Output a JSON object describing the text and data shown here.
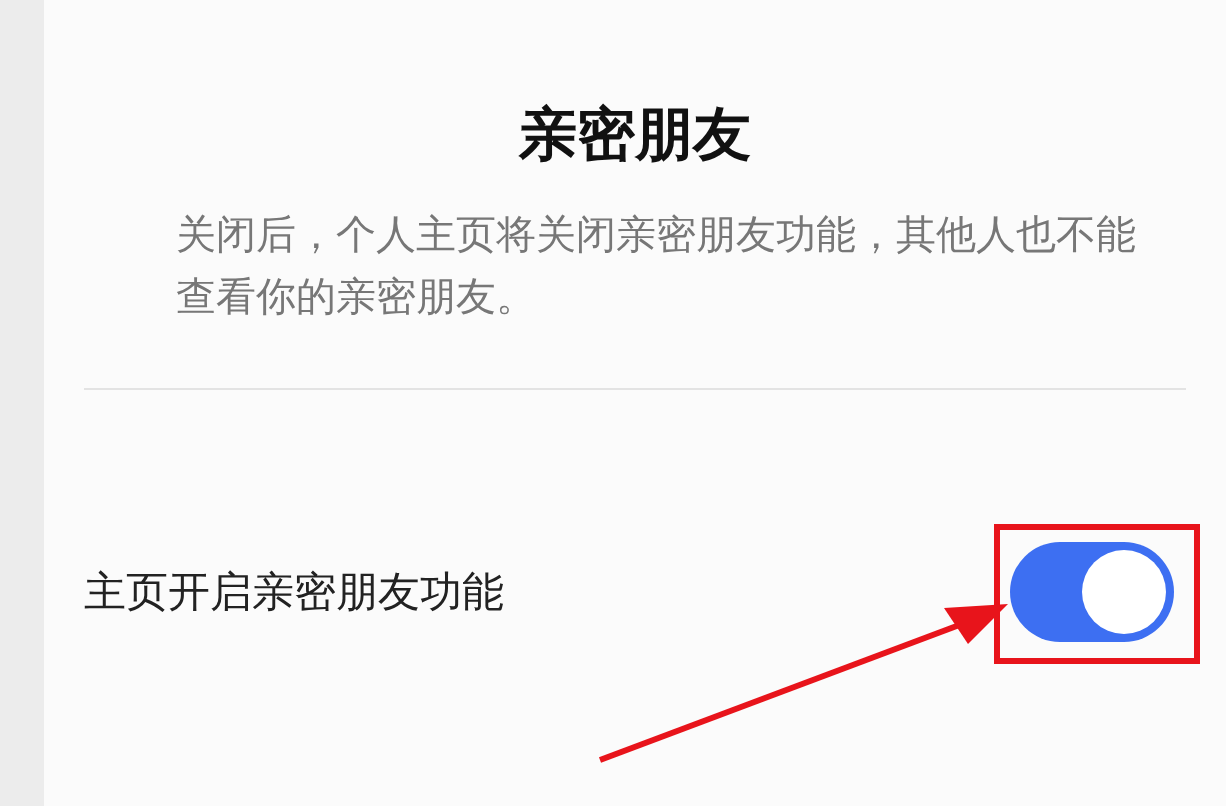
{
  "title": "亲密朋友",
  "description": "关闭后，个人主页将关闭亲密朋友功能，其他人也不能查看你的亲密朋友。",
  "setting": {
    "label": "主页开启亲密朋友功能",
    "on": true
  }
}
